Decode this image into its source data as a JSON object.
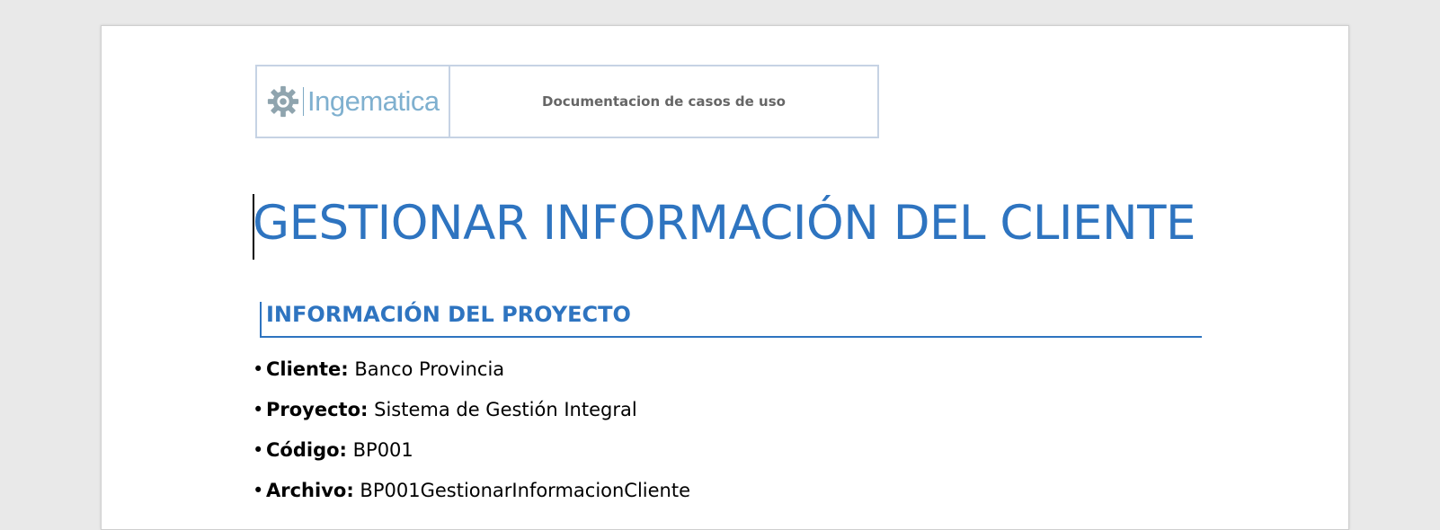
{
  "header": {
    "logo_text": "Ingematica",
    "doc_type": "Documentacion de casos de uso",
    "brand_color": "#7fb0cf"
  },
  "document": {
    "title": "GESTIONAR INFORMACIÓN DEL CLIENTE",
    "title_color": "#2e74c0"
  },
  "section": {
    "heading": "INFORMACIÓN DEL PROYECTO",
    "items": [
      {
        "bullet": "•",
        "label": "Cliente:",
        "value": "Banco Provincia"
      },
      {
        "bullet": "•",
        "label": "Proyecto:",
        "value": "Sistema de Gestión Integral"
      },
      {
        "bullet": "•",
        "label": "Código:",
        "value": "BP001"
      },
      {
        "bullet": "•",
        "label": "Archivo:",
        "value": "BP001GestionarInformacionCliente"
      }
    ]
  },
  "icons": {
    "logo": "gear-icon"
  }
}
